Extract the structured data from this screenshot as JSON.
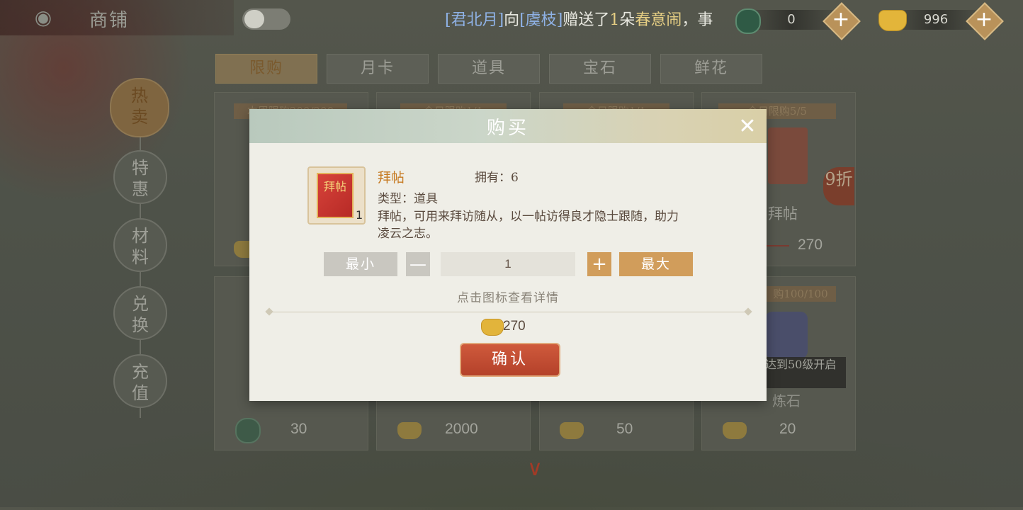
{
  "header": {
    "back_icon": "cloud-swirl-icon",
    "title": "商铺",
    "marquee": {
      "player1": "[君北月]",
      "word_to": "向",
      "player2": "[虞枝]",
      "word_gave": "赠送了",
      "count": "1",
      "word_unit": "朵",
      "flower": "春意闹",
      "tail": "，事"
    },
    "currencies": [
      {
        "icon": "jade-coin-icon",
        "value": "0"
      },
      {
        "icon": "gold-ingot-icon",
        "value": "996"
      }
    ]
  },
  "tabs": [
    {
      "label": "限购",
      "active": true
    },
    {
      "label": "月卡",
      "active": false
    },
    {
      "label": "道具",
      "active": false
    },
    {
      "label": "宝石",
      "active": false
    },
    {
      "label": "鲜花",
      "active": false
    }
  ],
  "side_categories": [
    {
      "label": "热卖",
      "active": true
    },
    {
      "label": "特惠",
      "active": false
    },
    {
      "label": "材料",
      "active": false
    },
    {
      "label": "兑换",
      "active": false
    },
    {
      "label": "充值",
      "active": false
    }
  ],
  "cards": [
    {
      "tag": "本周限购200/200",
      "price": "",
      "currency": "gold"
    },
    {
      "tag": "今日限购1/1",
      "price": "",
      "currency": "gold"
    },
    {
      "tag": "今日限购1/1",
      "price": "",
      "currency": "gold"
    },
    {
      "tag": "今日限购5/5",
      "name": "拜帖",
      "price": "270",
      "currency": "gold",
      "discount": "9折"
    },
    {
      "tag": "",
      "price": "30",
      "currency": "jade"
    },
    {
      "tag": "",
      "price": "2000",
      "currency": "gold"
    },
    {
      "tag": "",
      "price": "50",
      "currency": "gold"
    },
    {
      "tag": "购100/100",
      "name": "炼石",
      "price": "20",
      "currency": "gold",
      "lock_msg": "达到50级开启"
    }
  ],
  "dialog": {
    "title": "购买",
    "item": {
      "name": "拜帖",
      "icon_text": "拜帖",
      "count": "1",
      "own": "拥有：6",
      "type": "类型：道具",
      "description": "拜帖，可用来拜访随从，以一帖访得良才隐士跟随，助力凌云之志。"
    },
    "min_label": "最小",
    "dec_label": "—",
    "quantity": "1",
    "inc_label": "+",
    "max_label": "最大",
    "hint": "点击图标查看详情",
    "price": "270",
    "confirm_label": "确认"
  }
}
